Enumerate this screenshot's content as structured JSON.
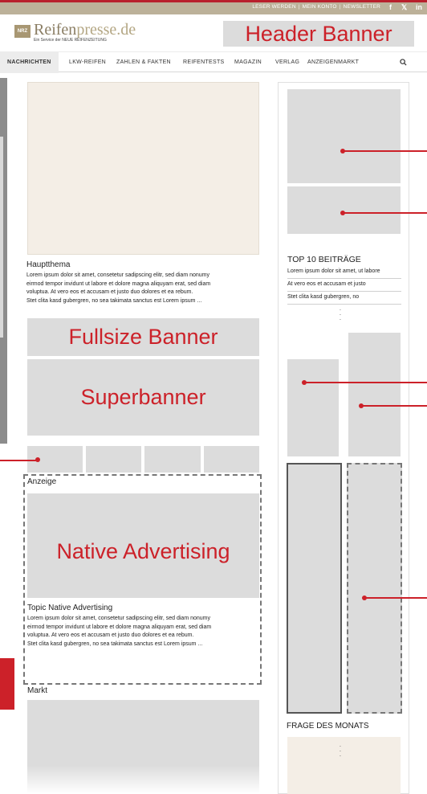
{
  "utility_bar": {
    "links": [
      "LESER WERDEN",
      "MEIN KONTO",
      "NEWSLETTER"
    ],
    "social": [
      "f",
      "𝕏",
      "in"
    ]
  },
  "logo": {
    "mark": "NRZ",
    "name_part1": "Reifen",
    "name_part2": "presse.de",
    "tagline": "Ein Service der NEUE REIFENZEITUNG"
  },
  "header_banner_label": "Header Banner",
  "nav": {
    "items": [
      "NACHRICHTEN",
      "LKW-REIFEN",
      "ZAHLEN & FAKTEN",
      "REIFENTESTS",
      "MAGAZIN",
      "VERLAG",
      "ANZEIGENMARKT"
    ],
    "search_icon": "search-icon"
  },
  "main": {
    "hauptthema_title": "Hauptthema",
    "hauptthema_lines": [
      "Lorem ipsum dolor sit amet, consetetur sadipscing elitr, sed diam nonumy",
      "eirmod tempor invidunt ut labore et dolore magna aliquyam erat, sed diam",
      "voluptua. At vero eos et accusam et justo duo dolores et ea rebum.",
      "Stet clita kasd gubergren, no sea takimata sanctus est Lorem ipsum ..."
    ],
    "fullsize_banner_label": "Fullsize Banner",
    "superbanner_label": "Superbanner",
    "anzeige_label": "Anzeige",
    "native_label": "Native Advertising",
    "topic_native_title": "Topic Native Advertising",
    "native_lines": [
      "Lorem ipsum dolor sit amet, consetetur sadipscing elitr, sed diam nonumy",
      "eirmod tempor invidunt ut labore et dolore magna aliquyam erat, sed diam",
      "voluptua. At vero eos et accusam et justo duo dolores et ea rebum.",
      "Stet clita kasd gubergren, no sea takimata sanctus est Lorem ipsum ..."
    ],
    "markt_label": "Markt"
  },
  "sidebar": {
    "top10_title": "TOP 10 BEITRÄGE",
    "top10_items": [
      "Lorem ipsum dolor sit amet, ut labore",
      "At vero eos et accusam et justo",
      "Stet clita kasd gubergren, no"
    ],
    "frage_title": "FRAGE DES MONATS"
  },
  "colors": {
    "accent": "#cc2129",
    "utility_bar": "#bcb199",
    "placeholder": "#dcdcdc",
    "cream": "#f4eee6"
  }
}
